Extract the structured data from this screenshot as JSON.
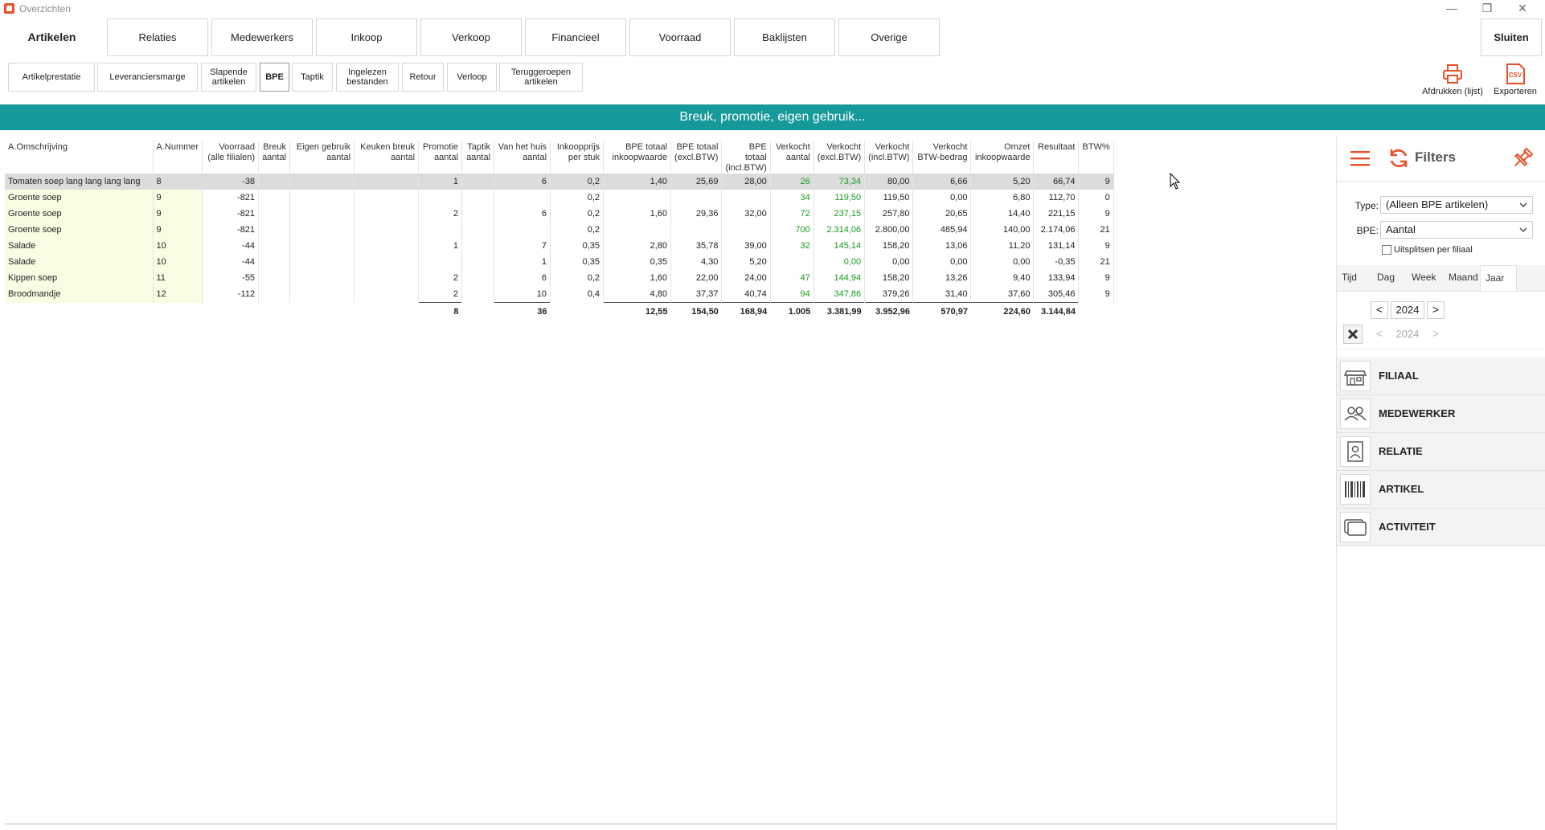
{
  "window": {
    "title": "Overzichten",
    "minimize": "—",
    "restore": "❐",
    "close": "✕"
  },
  "nav": {
    "section_label": "Artikelen",
    "tabs": [
      "Relaties",
      "Medewerkers",
      "Inkoop",
      "Verkoop",
      "Financieel",
      "Voorraad",
      "Baklijsten",
      "Overige"
    ],
    "close_label": "Sluiten"
  },
  "subnav": {
    "buttons": [
      {
        "label": "Artikelprestatie"
      },
      {
        "label": "Leveranciersmarge"
      },
      {
        "label": "Slapende\nartikelen"
      },
      {
        "label": "BPE",
        "active": true
      },
      {
        "label": "Taptik"
      },
      {
        "label": "Ingelezen\nbestanden"
      },
      {
        "label": "Retour"
      },
      {
        "label": "Verloop"
      },
      {
        "label": "Teruggeroepen\nartikelen"
      }
    ]
  },
  "actions": {
    "print_label": "Afdrukken (lijst)",
    "export_label": "Exporteren",
    "csv_glyph": "CSV"
  },
  "banner": {
    "text": "Breuk, promotie, eigen gebruik..."
  },
  "table": {
    "columns": [
      {
        "label": "A.Omschrijving",
        "align": "left"
      },
      {
        "label": "A.Nummer",
        "align": "left"
      },
      {
        "label": "Voorraad\n(alle filialen)"
      },
      {
        "label": "Breuk\naantal"
      },
      {
        "label": "Eigen gebruik\naantal"
      },
      {
        "label": "Keuken breuk\naantal"
      },
      {
        "label": "Promotie\naantal"
      },
      {
        "label": "Taptik\naantal"
      },
      {
        "label": "Van het huis\naantal"
      },
      {
        "label": "Inkoopprijs\nper stuk"
      },
      {
        "label": "BPE totaal\ninkoopwaarde"
      },
      {
        "label": "BPE totaal\n(excl.BTW)"
      },
      {
        "label": "BPE totaal\n(incl.BTW)"
      },
      {
        "label": "Verkocht\naantal"
      },
      {
        "label": "Verkocht\n(excl.BTW)"
      },
      {
        "label": "Verkocht\n(incl.BTW)"
      },
      {
        "label": "Verkocht\nBTW-bedrag"
      },
      {
        "label": "Omzet\ninkoopwaarde"
      },
      {
        "label": "Resultaat"
      },
      {
        "label": "BTW%"
      }
    ],
    "rows": [
      [
        "Tomaten soep lang lang lang lang",
        "8",
        "-38",
        "",
        "",
        "",
        "1",
        "",
        "6",
        "0,2",
        "1,40",
        "25,69",
        "28,00",
        "26",
        "73,34",
        "80,00",
        "6,66",
        "5,20",
        "66,74",
        "9"
      ],
      [
        "Groente soep",
        "9",
        "-821",
        "",
        "",
        "",
        "",
        "",
        "",
        "0,2",
        "",
        "",
        "",
        "34",
        "119,50",
        "119,50",
        "0,00",
        "6,80",
        "112,70",
        "0"
      ],
      [
        "Groente soep",
        "9",
        "-821",
        "",
        "",
        "",
        "2",
        "",
        "6",
        "0,2",
        "1,60",
        "29,36",
        "32,00",
        "72",
        "237,15",
        "257,80",
        "20,65",
        "14,40",
        "221,15",
        "9"
      ],
      [
        "Groente soep",
        "9",
        "-821",
        "",
        "",
        "",
        "",
        "",
        "",
        "0,2",
        "",
        "",
        "",
        "700",
        "2.314,06",
        "2.800,00",
        "485,94",
        "140,00",
        "2.174,06",
        "21"
      ],
      [
        "Salade",
        "10",
        "-44",
        "",
        "",
        "",
        "1",
        "",
        "7",
        "0,35",
        "2,80",
        "35,78",
        "39,00",
        "32",
        "145,14",
        "158,20",
        "13,06",
        "11,20",
        "131,14",
        "9"
      ],
      [
        "Salade",
        "10",
        "-44",
        "",
        "",
        "",
        "",
        "",
        "1",
        "0,35",
        "0,35",
        "4,30",
        "5,20",
        "",
        "0,00",
        "0,00",
        "0,00",
        "0,00",
        "-0,35",
        "21"
      ],
      [
        "Kippen soep",
        "11",
        "-55",
        "",
        "",
        "",
        "2",
        "",
        "6",
        "0,2",
        "1,60",
        "22,00",
        "24,00",
        "47",
        "144,94",
        "158,20",
        "13,26",
        "9,40",
        "133,94",
        "9"
      ],
      [
        "Broodmandje",
        "12",
        "-112",
        "",
        "",
        "",
        "2",
        "",
        "10",
        "0,4",
        "4,80",
        "37,37",
        "40,74",
        "94",
        "347,86",
        "379,26",
        "31,40",
        "37,60",
        "305,46",
        "9"
      ]
    ],
    "totals": [
      "",
      "",
      "",
      "",
      "",
      "",
      "8",
      "",
      "36",
      "",
      "12,55",
      "154,50",
      "168,94",
      "1.005",
      "3.381,99",
      "3.952,96",
      "570,97",
      "224,60",
      "3.144,84",
      ""
    ],
    "selected_row": 0,
    "green_columns": [
      13,
      14
    ],
    "colors": {
      "green": "#179b1f",
      "name_bg": "#fbfce4",
      "selected_bg": "#dcdcdc"
    }
  },
  "filters": {
    "title": "Filters",
    "type_label": "Type:",
    "type_value": "(Alleen BPE artikelen)",
    "bpe_label": "BPE:",
    "bpe_value": "Aantal",
    "split_label": "Uitsplitsen per filiaal",
    "time_tabs": [
      "Tijd",
      "Dag",
      "Week",
      "Maand",
      "Jaar"
    ],
    "active_time_tab": "Jaar",
    "year_from": "2024",
    "year_to": "2024",
    "prev_glyph": "<",
    "next_glyph": ">",
    "categories": [
      {
        "label": "FILIAAL",
        "icon": "store-icon"
      },
      {
        "label": "MEDEWERKER",
        "icon": "users-icon"
      },
      {
        "label": "RELATIE",
        "icon": "contact-icon"
      },
      {
        "label": "ARTIKEL",
        "icon": "barcode-icon"
      },
      {
        "label": "ACTIVITEIT",
        "icon": "activity-icon"
      }
    ]
  },
  "theme": {
    "accent": "#16999a",
    "orange": "#e8502a"
  }
}
